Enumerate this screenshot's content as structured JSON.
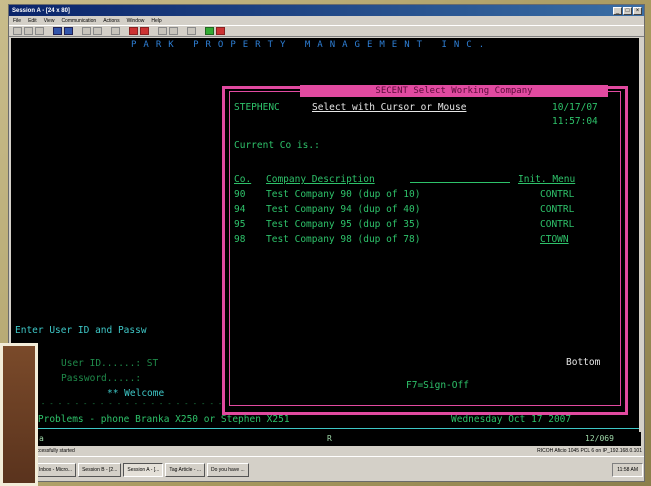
{
  "window": {
    "title": "Session A - [24 x 80]",
    "controls": [
      "_",
      "□",
      "×"
    ],
    "menu": [
      "File",
      "Edit",
      "View",
      "Communication",
      "Actions",
      "Window",
      "Help"
    ]
  },
  "terminal": {
    "company_banner": "PARK PROPERTY MANAGEMENT INC.",
    "login_prompt": "Enter User ID and Passw",
    "user_id_label": "User ID......: ST",
    "password_label": "Password.....:",
    "welcome": "** Welcome",
    "help_line": "Any Problems - phone Branka X250 or Stephen X251",
    "date_line": "Wednesday Oct 17 2007",
    "dots": "- - - - - - - - - - - - - - - - - - - - - - - -"
  },
  "popup": {
    "title": "SECENT Select Working Company",
    "user": "STEPHENC",
    "instruction": "Select with Cursor or Mouse",
    "date": "10/17/07",
    "time": "11:57:04",
    "current_label": "Current Co is.:",
    "headers": {
      "co": "Co.",
      "desc": "Company Description",
      "menu": "Init. Menu"
    },
    "rows": [
      {
        "co": "90",
        "desc": "Test Company 90 (dup of 10)",
        "menu": "CONTRL"
      },
      {
        "co": "94",
        "desc": "Test Company 94 (dup of 40)",
        "menu": "CONTRL"
      },
      {
        "co": "95",
        "desc": "Test Company 95 (dup of 35)",
        "menu": "CONTRL"
      },
      {
        "co": "98",
        "desc": "Test Company 98 (dup of 78)",
        "menu": "CTOWN"
      }
    ],
    "bottom": "Bottom",
    "signoff": "F7=Sign-Off"
  },
  "ruler": {
    "mode": "a",
    "indicator": "R",
    "cursor_pos": "12/069"
  },
  "statusbar": {
    "message": "Session successfully started",
    "right": "RICOH Aficio 1045 PCL 6 on IP_192.168.0.101"
  },
  "taskbar": {
    "tasks": [
      "Inbox - Micro...",
      "Session B - [2...",
      "Session A - [...",
      "Tag Article - ...",
      "Do you have ..."
    ],
    "active_task_index": 2,
    "clock": "11:58 AM"
  },
  "colors": {
    "terminal_bg": "#000000",
    "terminal_green": "#2ec26a",
    "popup_border": "#e14aa0",
    "banner_blue": "#2e7fd6"
  }
}
